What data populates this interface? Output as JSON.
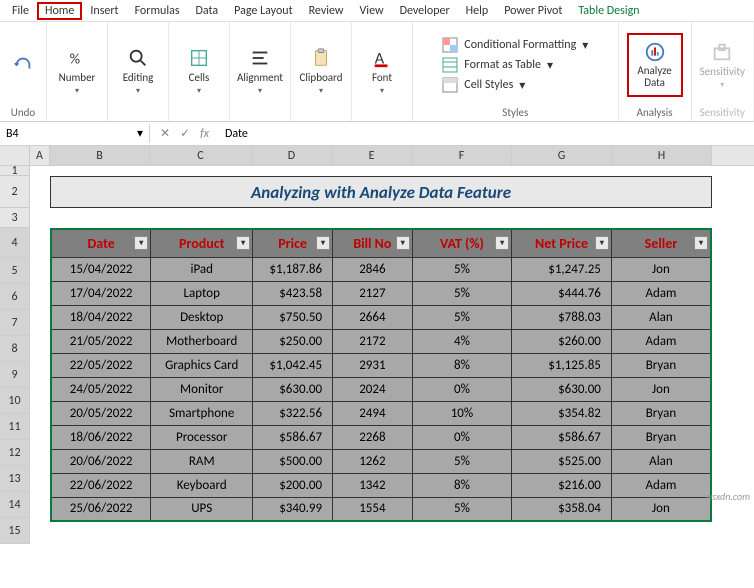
{
  "menubar": [
    "File",
    "Home",
    "Insert",
    "Formulas",
    "Data",
    "Page Layout",
    "Review",
    "View",
    "Developer",
    "Help",
    "Power Pivot",
    "Table Design"
  ],
  "ribbon": {
    "undo": "Undo",
    "number": "Number",
    "editing": "Editing",
    "cells": "Cells",
    "alignment": "Alignment",
    "clipboard": "Clipboard",
    "font": "Font",
    "styles_label": "Styles",
    "cond_formatting": "Conditional Formatting",
    "format_table": "Format as Table",
    "cell_styles": "Cell Styles",
    "analyze": "Analyze\nData",
    "analysis": "Analysis",
    "sensitivity": "Sensitivity",
    "sensitivity_label": "Sensitivity"
  },
  "namebox": "B4",
  "formula": "Date",
  "columns": [
    "A",
    "B",
    "C",
    "D",
    "E",
    "F",
    "G",
    "H"
  ],
  "row_numbers": [
    "1",
    "2",
    "3",
    "4",
    "5",
    "6",
    "7",
    "8",
    "9",
    "10",
    "11",
    "12",
    "13",
    "14",
    "15"
  ],
  "title": "Analyzing with Analyze Data Feature",
  "headers": [
    "Date",
    "Product",
    "Price",
    "Bill No",
    "VAT (%)",
    "Net Price",
    "Seller"
  ],
  "rows": [
    {
      "date": "15/04/2022",
      "product": "iPad",
      "price": "$1,187.86",
      "bill": "2846",
      "vat": "5%",
      "net": "$1,247.25",
      "seller": "Jon"
    },
    {
      "date": "17/04/2022",
      "product": "Laptop",
      "price": "$423.58",
      "bill": "2127",
      "vat": "5%",
      "net": "$444.76",
      "seller": "Adam"
    },
    {
      "date": "18/04/2022",
      "product": "Desktop",
      "price": "$750.50",
      "bill": "2664",
      "vat": "5%",
      "net": "$788.03",
      "seller": "Alan"
    },
    {
      "date": "21/05/2022",
      "product": "Motherboard",
      "price": "$250.00",
      "bill": "2172",
      "vat": "4%",
      "net": "$260.00",
      "seller": "Adam"
    },
    {
      "date": "22/05/2022",
      "product": "Graphics Card",
      "price": "$1,042.45",
      "bill": "2931",
      "vat": "8%",
      "net": "$1,125.85",
      "seller": "Bryan"
    },
    {
      "date": "24/05/2022",
      "product": "Monitor",
      "price": "$630.00",
      "bill": "2024",
      "vat": "0%",
      "net": "$630.00",
      "seller": "Jon"
    },
    {
      "date": "20/05/2022",
      "product": "Smartphone",
      "price": "$322.56",
      "bill": "2494",
      "vat": "10%",
      "net": "$354.82",
      "seller": "Bryan"
    },
    {
      "date": "18/06/2022",
      "product": "Processor",
      "price": "$586.67",
      "bill": "2268",
      "vat": "0%",
      "net": "$586.67",
      "seller": "Bryan"
    },
    {
      "date": "20/06/2022",
      "product": "RAM",
      "price": "$500.00",
      "bill": "1262",
      "vat": "5%",
      "net": "$525.00",
      "seller": "Alan"
    },
    {
      "date": "22/06/2022",
      "product": "Keyboard",
      "price": "$200.00",
      "bill": "1342",
      "vat": "8%",
      "net": "$216.00",
      "seller": "Adam"
    },
    {
      "date": "25/06/2022",
      "product": "UPS",
      "price": "$340.99",
      "bill": "1554",
      "vat": "5%",
      "net": "$358.04",
      "seller": "Jon"
    }
  ],
  "watermark": "wsxdn.com"
}
